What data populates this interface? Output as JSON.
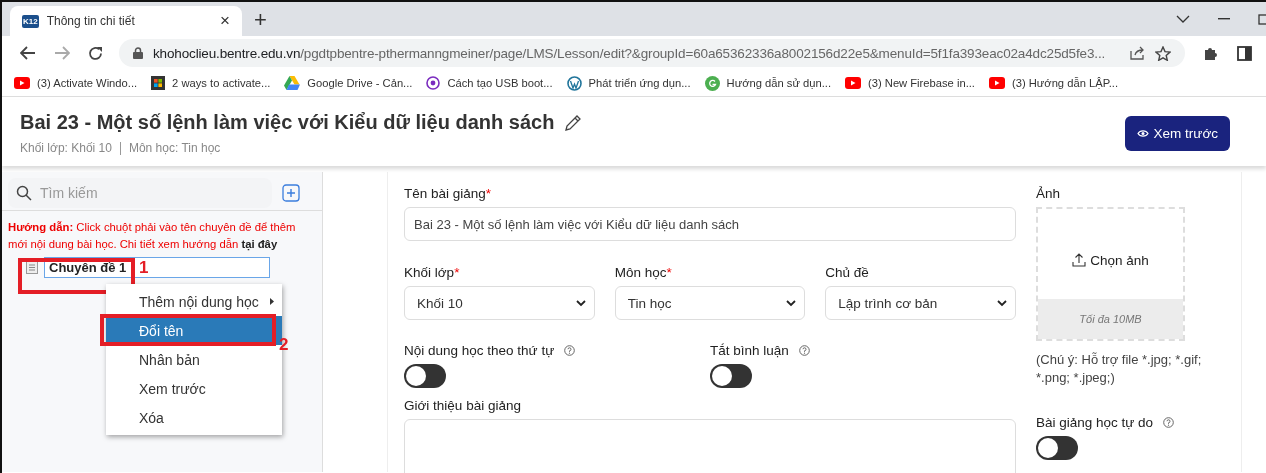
{
  "browser": {
    "tab": {
      "logo": "K12",
      "title": "Thông tin chi tiết",
      "close": "×",
      "new_tab": "+"
    },
    "url": {
      "host": "khohoclieu.bentre.edu.vn",
      "path": "/pgdtpbentre-pthermanngmeiner/page/LMS/Lesson/edit?&groupId=60a65362336a8002156d22e5&menuId=5f1fa393eac02a4dc25d5fe3..."
    },
    "bookmarks": [
      {
        "kind": "youtube",
        "label": "(3) Activate Windo..."
      },
      {
        "kind": "windows",
        "label": "2 ways to activate..."
      },
      {
        "kind": "drive",
        "label": "Google Drive - Cản..."
      },
      {
        "kind": "podcast",
        "label": "Cách tạo USB boot..."
      },
      {
        "kind": "wordpress",
        "label": "Phát triển ứng dụn..."
      },
      {
        "kind": "g",
        "label": "Hướng dẫn sử dụn..."
      },
      {
        "kind": "youtube",
        "label": "(3) New Firebase in..."
      },
      {
        "kind": "youtube",
        "label": "(3) Hướng dẫn LẬP..."
      }
    ]
  },
  "header": {
    "title": "Bai 23 - Một số lệnh làm việc với Kiểu dữ liệu danh sách",
    "meta": [
      "Khối lớp: Khối 10",
      "Môn học: Tin học"
    ],
    "preview_button": "Xem trước"
  },
  "sidebar": {
    "search": {
      "placeholder": "Tìm kiếm"
    },
    "hint": "**Hướng dẫn:** Click chuột phải vào tên chuyên đề để thêm mới nội dung bài học. Chi tiết xem hướng dẫn",
    "hint_link": "tại đây",
    "tree": [
      {
        "label": "Chuyên đề 1",
        "selected": true
      }
    ]
  },
  "context_menu": {
    "items": [
      {
        "label": "Thêm nội dung học",
        "submenu": true,
        "selected": false
      },
      {
        "label": "Đổi tên",
        "submenu": false,
        "selected": true
      },
      {
        "label": "Nhân bản",
        "submenu": false,
        "selected": false
      },
      {
        "label": "Xem trước",
        "submenu": false,
        "selected": false
      },
      {
        "label": "Xóa",
        "submenu": false,
        "selected": false
      }
    ]
  },
  "annotations": [
    {
      "label": "1"
    },
    {
      "label": "2"
    }
  ],
  "form": {
    "lesson_name": {
      "label": "Tên bài giảng",
      "required_mark": "*",
      "value": "Bai 23 -  Một số lệnh làm việc với Kiểu dữ liệu danh sách"
    },
    "selects": [
      {
        "label": "Khối lớp",
        "required_mark": "*",
        "value": "Khối 10"
      },
      {
        "label": "Môn học",
        "required_mark": "*",
        "value": "Tin học"
      },
      {
        "label": "Chủ đề",
        "value": "Lập trình cơ bản"
      }
    ],
    "toggles": [
      {
        "label": "Nội dung học theo thứ tự",
        "on": false
      },
      {
        "label": "Tắt bình luận",
        "on": false
      }
    ],
    "intro": {
      "label": "Giới thiệu bài giảng"
    },
    "image": {
      "label": "Ảnh",
      "button": "Chọn ảnh",
      "limit": "Tối đa 10MB",
      "note": "(Chú ý: Hỗ trợ file *.jpg; *.gif; *.png; *.jpeg;)"
    },
    "free_toggle": {
      "label": "Bài giảng học tự do",
      "on": false
    }
  }
}
